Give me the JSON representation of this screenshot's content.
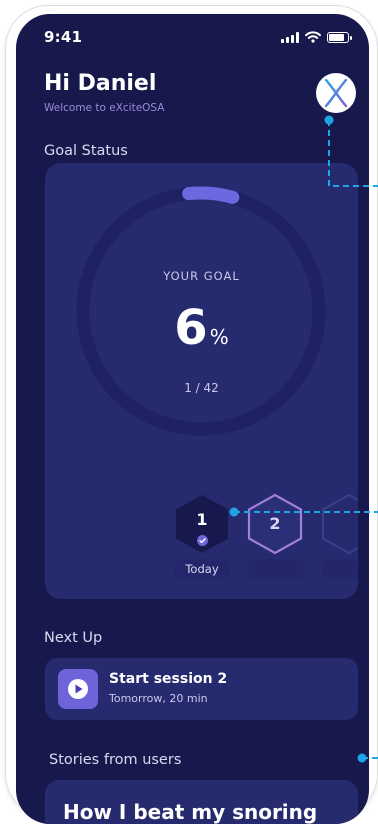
{
  "status_bar": {
    "time": "9:41"
  },
  "header": {
    "greeting": "Hi Daniel",
    "subtitle": "Welcome to eXciteOSA",
    "avatar_icon": "x-logo-icon"
  },
  "goal": {
    "section_title": "Goal Status",
    "label": "YOUR GOAL",
    "percent_value": "6",
    "percent_sign": "%",
    "count": "1 / 42",
    "progress": 0.06,
    "days": [
      {
        "number": "1",
        "label": "Today",
        "state": "completed"
      },
      {
        "number": "2",
        "label": "",
        "state": "next"
      },
      {
        "number": "",
        "label": "",
        "state": "locked"
      }
    ]
  },
  "next_up": {
    "section_title": "Next Up",
    "session_name": "Start session 2",
    "session_meta": "Tomorrow, 20 min",
    "icon": "play-icon"
  },
  "stories": {
    "section_title": "Stories from users",
    "preview_text": "How I beat my snoring"
  },
  "colors": {
    "background": "#17194d",
    "card": "#262a6f",
    "accent": "#6f63d9",
    "connector": "#1da6e6"
  }
}
